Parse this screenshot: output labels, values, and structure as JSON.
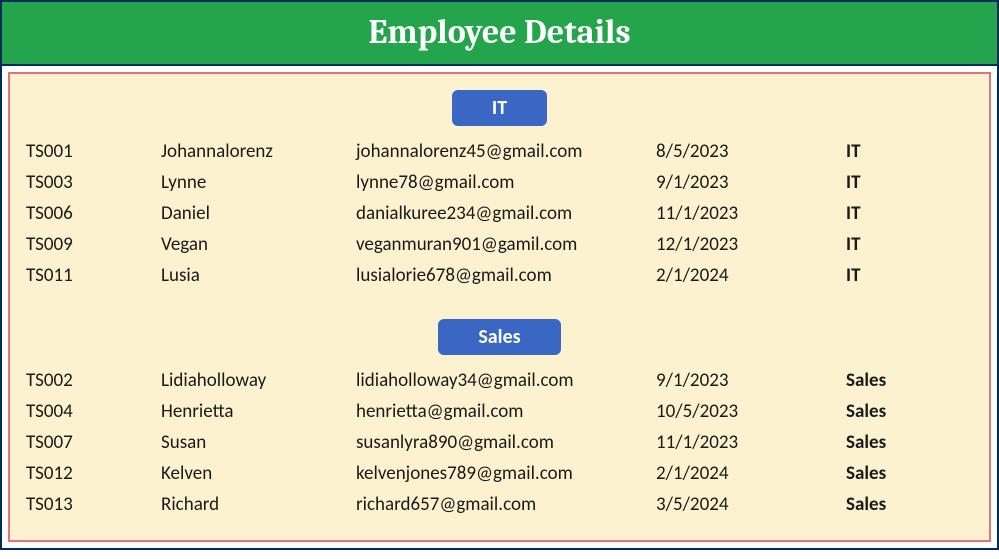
{
  "title": "Employee Details",
  "groups": [
    {
      "name": "IT",
      "rows": [
        {
          "id": "TS001",
          "name": "Johannalorenz",
          "email": "johannalorenz45@gmail.com",
          "date": "8/5/2023",
          "dept": "IT"
        },
        {
          "id": "TS003",
          "name": "Lynne",
          "email": "lynne78@gmail.com",
          "date": "9/1/2023",
          "dept": "IT"
        },
        {
          "id": "TS006",
          "name": "Daniel",
          "email": "danialkuree234@gmail.com",
          "date": "11/1/2023",
          "dept": "IT"
        },
        {
          "id": "TS009",
          "name": "Vegan",
          "email": "veganmuran901@gamil.com",
          "date": "12/1/2023",
          "dept": "IT"
        },
        {
          "id": "TS011",
          "name": "Lusia",
          "email": "lusialorie678@gmail.com",
          "date": "2/1/2024",
          "dept": "IT"
        }
      ]
    },
    {
      "name": "Sales",
      "rows": [
        {
          "id": "TS002",
          "name": "Lidiaholloway",
          "email": "lidiaholloway34@gmail.com",
          "date": "9/1/2023",
          "dept": "Sales"
        },
        {
          "id": "TS004",
          "name": "Henrietta",
          "email": "henrietta@gmail.com",
          "date": "10/5/2023",
          "dept": "Sales"
        },
        {
          "id": "TS007",
          "name": "Susan",
          "email": "susanlyra890@gmail.com",
          "date": "11/1/2023",
          "dept": "Sales"
        },
        {
          "id": "TS012",
          "name": "Kelven",
          "email": "kelvenjones789@gmail.com",
          "date": "2/1/2024",
          "dept": "Sales"
        },
        {
          "id": "TS013",
          "name": "Richard",
          "email": "richard657@gmail.com",
          "date": "3/5/2024",
          "dept": "Sales"
        }
      ]
    }
  ]
}
